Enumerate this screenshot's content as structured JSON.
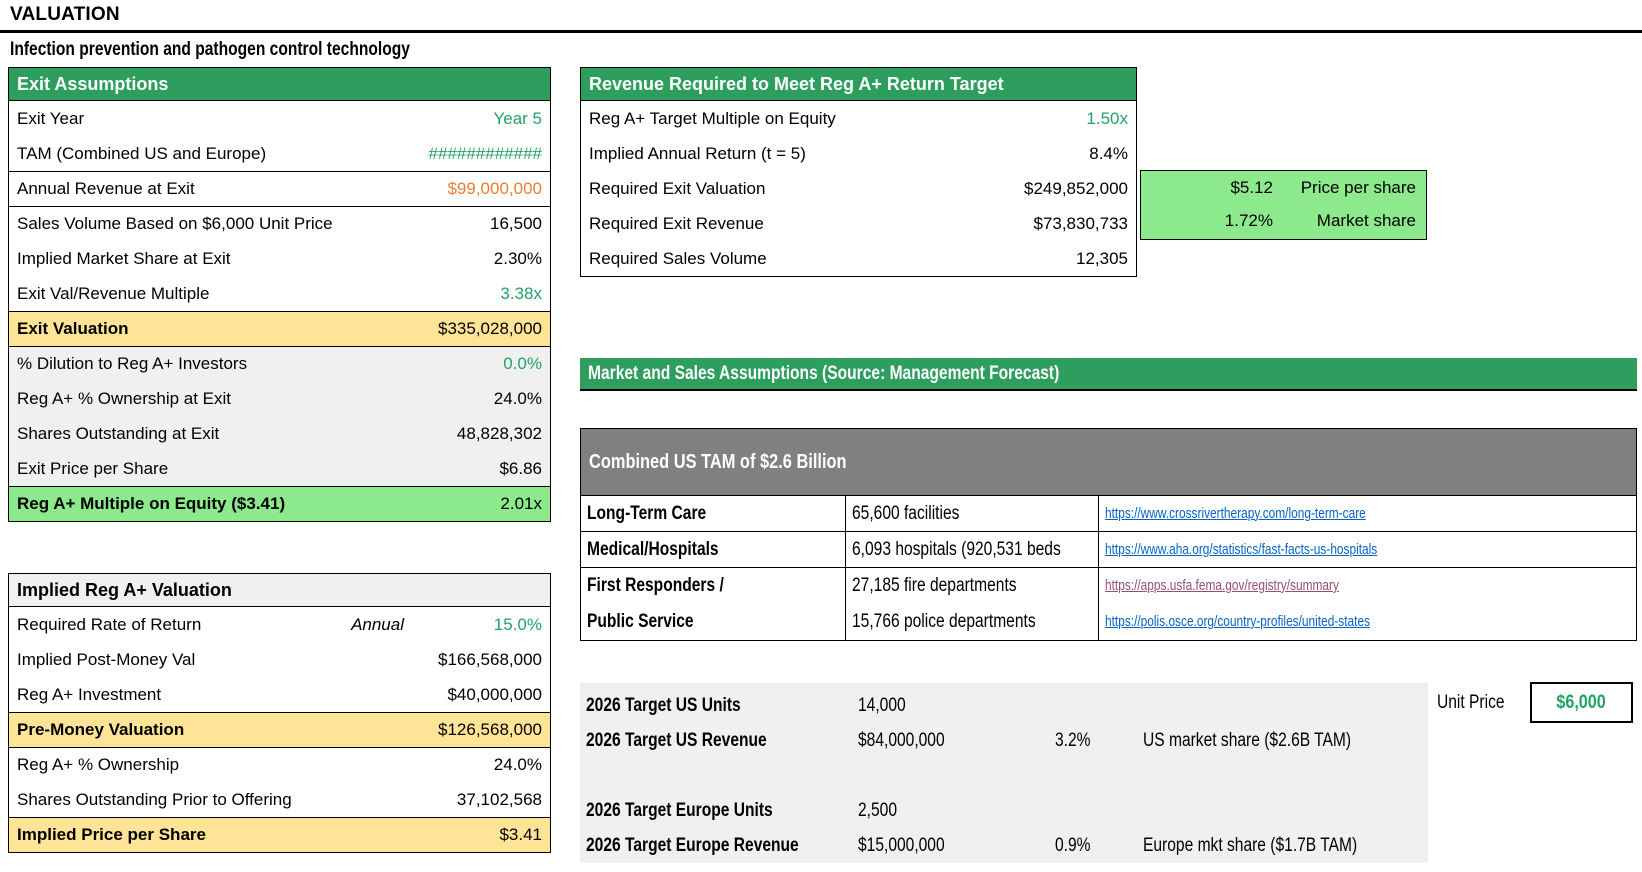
{
  "colors": {
    "green_header": "#2E9E5E",
    "green_text": "#21A364",
    "orange_text": "#ED7D31",
    "yellow_bg": "#FFE396",
    "bright_green_bg": "#8CE98C",
    "light_gray_bg": "#F0F0F0",
    "gray_header": "#808080",
    "link_blue": "#0563C1",
    "link_visited": "#954F72"
  },
  "page": {
    "title": "VALUATION",
    "subtitle": "Infection prevention and pathogen control technology"
  },
  "exit_assumptions": {
    "title": "Exit Assumptions",
    "rows": [
      {
        "label": "Exit Year",
        "value": "Year 5"
      },
      {
        "label": "TAM (Combined US and Europe)",
        "value": "############"
      },
      {
        "label": "Annual Revenue at Exit",
        "value": "$99,000,000"
      },
      {
        "label": "Sales Volume Based on $6,000 Unit Price",
        "value": "16,500"
      },
      {
        "label": "Implied Market Share at Exit",
        "value": "2.30%"
      },
      {
        "label": "Exit Val/Revenue Multiple",
        "value": "3.38x"
      },
      {
        "label": "Exit Valuation",
        "value": "$335,028,000"
      },
      {
        "label": "% Dilution to Reg A+ Investors",
        "value": "0.0%"
      },
      {
        "label": "Reg A+ % Ownership at Exit",
        "value": "24.0%"
      },
      {
        "label": "Shares Outstanding at Exit",
        "value": "48,828,302"
      },
      {
        "label": "Exit Price per Share",
        "value": "$6.86"
      },
      {
        "label": "Reg A+ Multiple on Equity ($3.41)",
        "value": "2.01x"
      }
    ]
  },
  "implied_valuation": {
    "title": "Implied Reg A+ Valuation",
    "rows": [
      {
        "label": "Required Rate of Return",
        "middle": "Annual",
        "value": "15.0%"
      },
      {
        "label": "Implied Post-Money Val",
        "value": "$166,568,000"
      },
      {
        "label": "Reg A+ Investment",
        "value": "$40,000,000"
      },
      {
        "label": "Pre-Money Valuation",
        "value": "$126,568,000"
      },
      {
        "label": "Reg A+ % Ownership",
        "value": "24.0%"
      },
      {
        "label": "Shares Outstanding Prior to Offering",
        "value": "37,102,568"
      },
      {
        "label": "Implied Price per Share",
        "value": "$3.41"
      }
    ]
  },
  "revenue_required": {
    "title": "Revenue Required to Meet Reg A+ Return Target",
    "rows": [
      {
        "label": "Reg A+ Target Multiple on Equity",
        "value": "1.50x"
      },
      {
        "label": "Implied Annual Return (t = 5)",
        "value": "8.4%"
      },
      {
        "label": "Required Exit Valuation",
        "value": "$249,852,000"
      },
      {
        "label": "Required Exit Revenue",
        "value": "$73,830,733"
      },
      {
        "label": "Required Sales Volume",
        "value": "12,305"
      }
    ]
  },
  "summary_box": {
    "rows": [
      {
        "value": "$5.12",
        "label": "Price per share"
      },
      {
        "value": "1.72%",
        "label": "Market share"
      }
    ]
  },
  "market_assumptions": {
    "title": "Market and Sales Assumptions (Source: Management Forecast)",
    "tam_table": {
      "header": "Combined US TAM of $2.6 Billion",
      "rows": [
        {
          "segment": "Long-Term Care",
          "stat": "65,600 facilities",
          "link": "https://www.crossrivertherapy.com/long-term-care"
        },
        {
          "segment": "Medical/Hospitals",
          "stat": "6,093 hospitals (920,531 beds",
          "link": "https://www.aha.org/statistics/fast-facts-us-hospitals"
        },
        {
          "segment": "First Responders /",
          "stat": "27,185 fire departments",
          "link": "https://apps.usfa.fema.gov/registry/summary"
        },
        {
          "segment": "Public Service",
          "stat": "15,766 police departments",
          "link": "https://polis.osce.org/country-profiles/united-states"
        }
      ]
    },
    "targets": [
      {
        "label": "2026 Target US Units",
        "value": "14,000",
        "pct": "",
        "note": ""
      },
      {
        "label": "2026 Target US Revenue",
        "value": "$84,000,000",
        "pct": "3.2%",
        "note": "US market share ($2.6B TAM)"
      },
      {
        "label": "2026 Target Europe Units",
        "value": "2,500",
        "pct": "",
        "note": ""
      },
      {
        "label": "2026 Target Europe Revenue",
        "value": "$15,000,000",
        "pct": "0.9%",
        "note": "Europe mkt share ($1.7B TAM)"
      }
    ],
    "unit_price_label": "Unit Price",
    "unit_price_value": "$6,000"
  }
}
